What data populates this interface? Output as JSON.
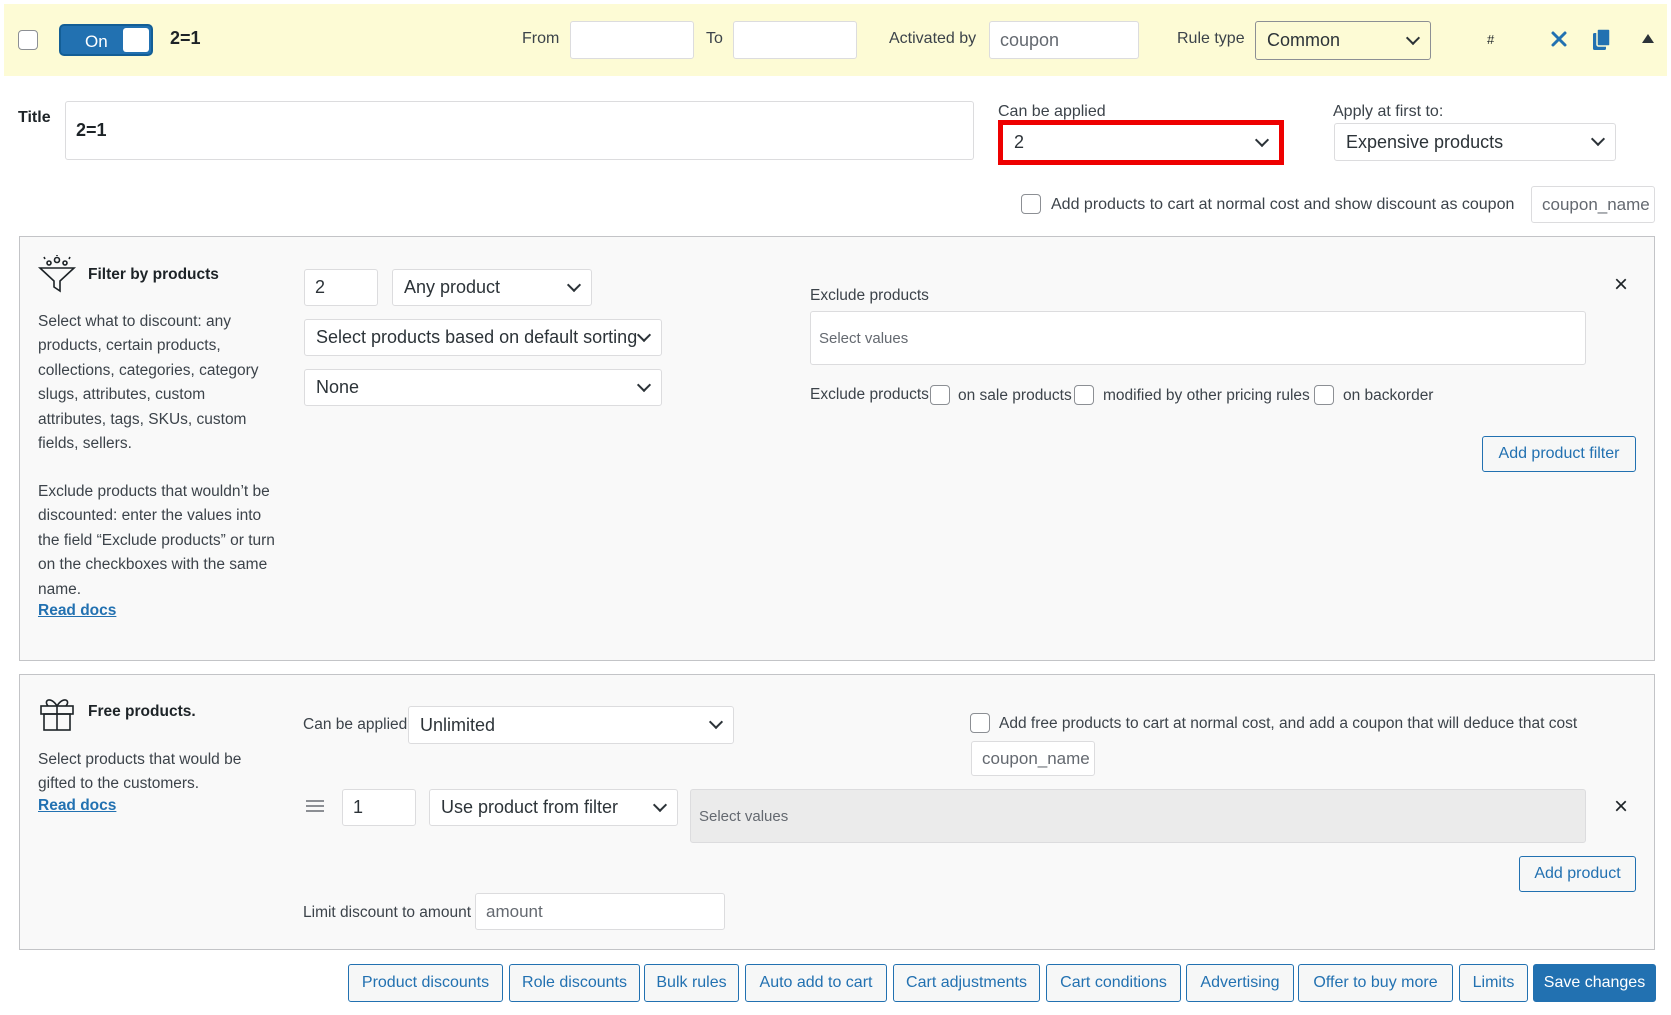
{
  "header": {
    "toggle_label": "On",
    "rule_name": "2=1",
    "from_label": "From",
    "from_value": "",
    "to_label": "To",
    "to_value": "",
    "activated_by_label": "Activated by",
    "activated_by_value": "coupon",
    "rule_type_label": "Rule type",
    "rule_type_value": "Common",
    "hash_label": "#",
    "bg_color": "#fdfbd5"
  },
  "title_row": {
    "title_label": "Title",
    "title_value": "2=1",
    "can_be_applied_label": "Can be applied",
    "can_be_applied_value": "2",
    "apply_first_label": "Apply at first to:",
    "apply_first_value": "Expensive products",
    "coupon_checkbox_label": "Add products to cart at normal cost and show discount as coupon",
    "coupon_name_placeholder": "coupon_name",
    "highlight_color": "#ee0000"
  },
  "filter": {
    "heading": "Filter by products",
    "description_1": "Select what to discount: any products, certain products, collections, categories, category slugs, attributes, custom attributes, tags, SKUs, custom fields, sellers.",
    "description_2": "Exclude products that wouldn’t be discounted: enter the values into the field “Exclude products” or turn on the checkboxes with the same name.",
    "read_docs": "Read docs",
    "qty_value": "2",
    "product_type": "Any product",
    "sorting": "Select products based on default sorting",
    "secondary": "None",
    "exclude_label": "Exclude products",
    "exclude_placeholder": "Select values",
    "exclude_checks_label": "Exclude products",
    "check_on_sale": "on sale products",
    "check_modified": "modified by other pricing rules",
    "check_backorder": "on backorder",
    "add_filter_button": "Add product filter"
  },
  "free": {
    "heading": "Free products.",
    "description": "Select products that would be gifted to the customers.",
    "read_docs": "Read docs",
    "can_be_applied_label": "Can be applied",
    "can_be_applied_value": "Unlimited",
    "free_cost_label": "Add free products to cart at normal cost, and add a coupon that will deduce that cost",
    "coupon_name_placeholder": "coupon_name",
    "qty_value": "1",
    "product_source": "Use product from filter",
    "values_placeholder": "Select values",
    "add_product_button": "Add product",
    "limit_label": "Limit discount to amount",
    "limit_placeholder": "amount"
  },
  "footer": {
    "buttons": [
      "Product discounts",
      "Role discounts",
      "Bulk rules",
      "Auto add to cart",
      "Cart adjustments",
      "Cart conditions",
      "Advertising",
      "Offer to buy more",
      "Limits"
    ],
    "save_label": "Save changes"
  }
}
